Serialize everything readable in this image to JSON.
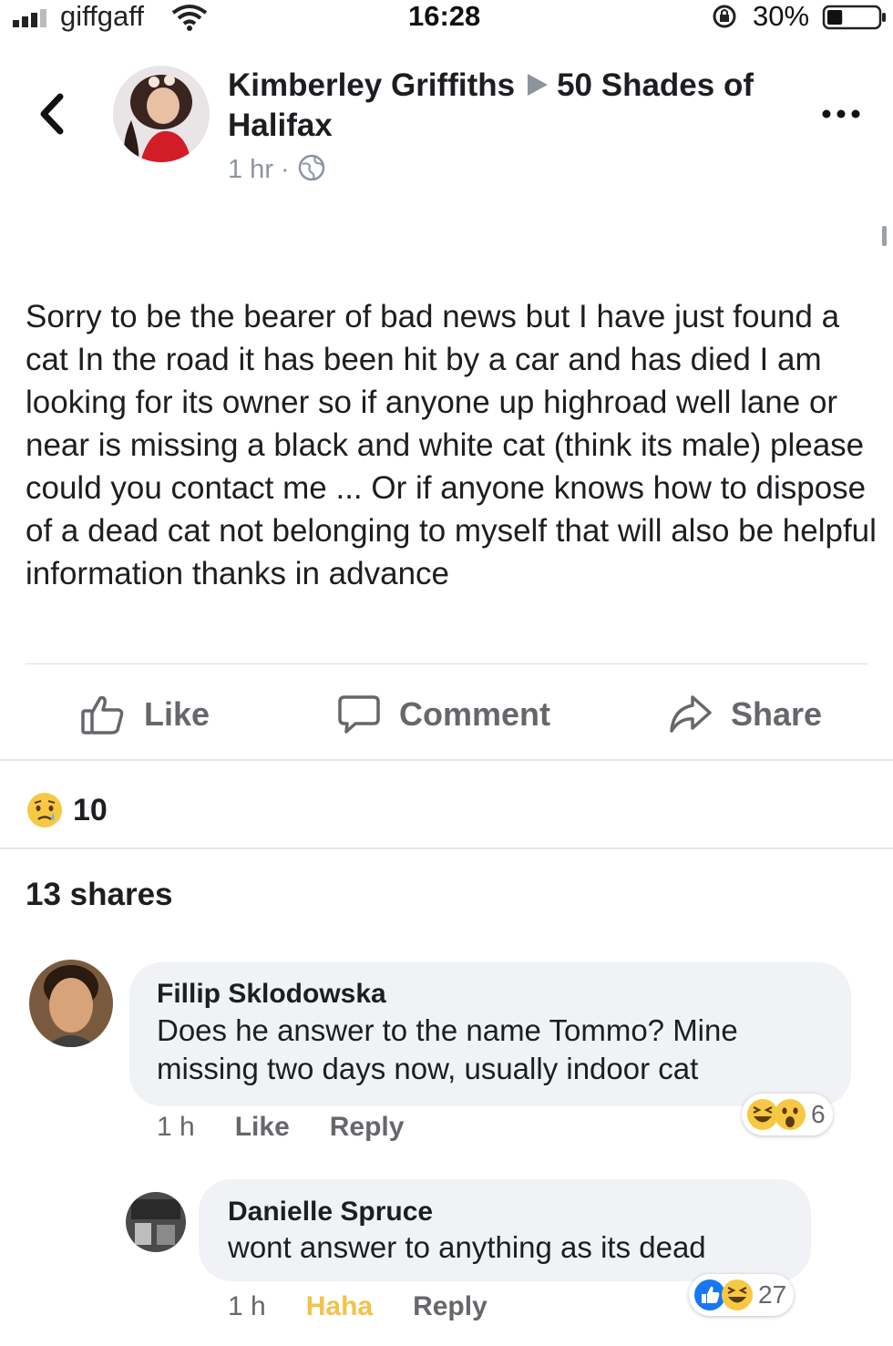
{
  "status_bar": {
    "carrier": "giffgaff",
    "time": "16:28",
    "battery_percent": "30%",
    "battery_level": 0.3
  },
  "post": {
    "author": "Kimberley Griffiths",
    "group": "50 Shades of Halifax",
    "time": "1 hr",
    "privacy_icon": "globe-icon",
    "body": "Sorry to be the bearer of bad news but I have just found a cat In the road it has been hit by a car and has died I am looking for its owner so if anyone up highroad well lane or near is missing a black and white cat (think its male) please could you contact me ... Or if anyone knows how to dispose of a dead cat not belonging to myself that will also be helpful information thanks in advance"
  },
  "actions": {
    "like": "Like",
    "comment": "Comment",
    "share": "Share"
  },
  "reactions": {
    "icon": "sad-emoji-icon",
    "count": "10"
  },
  "shares": "13 shares",
  "comments": [
    {
      "name": "Fillip Sklodowska",
      "text": "Does he answer to the name Tommo? Mine missing two days now, usually indoor cat",
      "time": "1 h",
      "like_label": "Like",
      "reply_label": "Reply",
      "reaction_icons": [
        "laugh-emoji-icon",
        "wow-emoji-icon"
      ],
      "reaction_count": "6"
    },
    {
      "name": "Danielle Spruce",
      "text": "wont answer to anything as its dead",
      "time": "1 h",
      "like_label": "Haha",
      "reply_label": "Reply",
      "reaction_icons": [
        "like-icon",
        "laugh-emoji-icon"
      ],
      "reaction_count": "27"
    }
  ],
  "colors": {
    "text_primary": "#1c1e21",
    "text_secondary": "#65676b",
    "haha_reaction": "#f2c24a",
    "like_blue": "#1877f2",
    "bubble_bg": "#f0f2f5"
  }
}
